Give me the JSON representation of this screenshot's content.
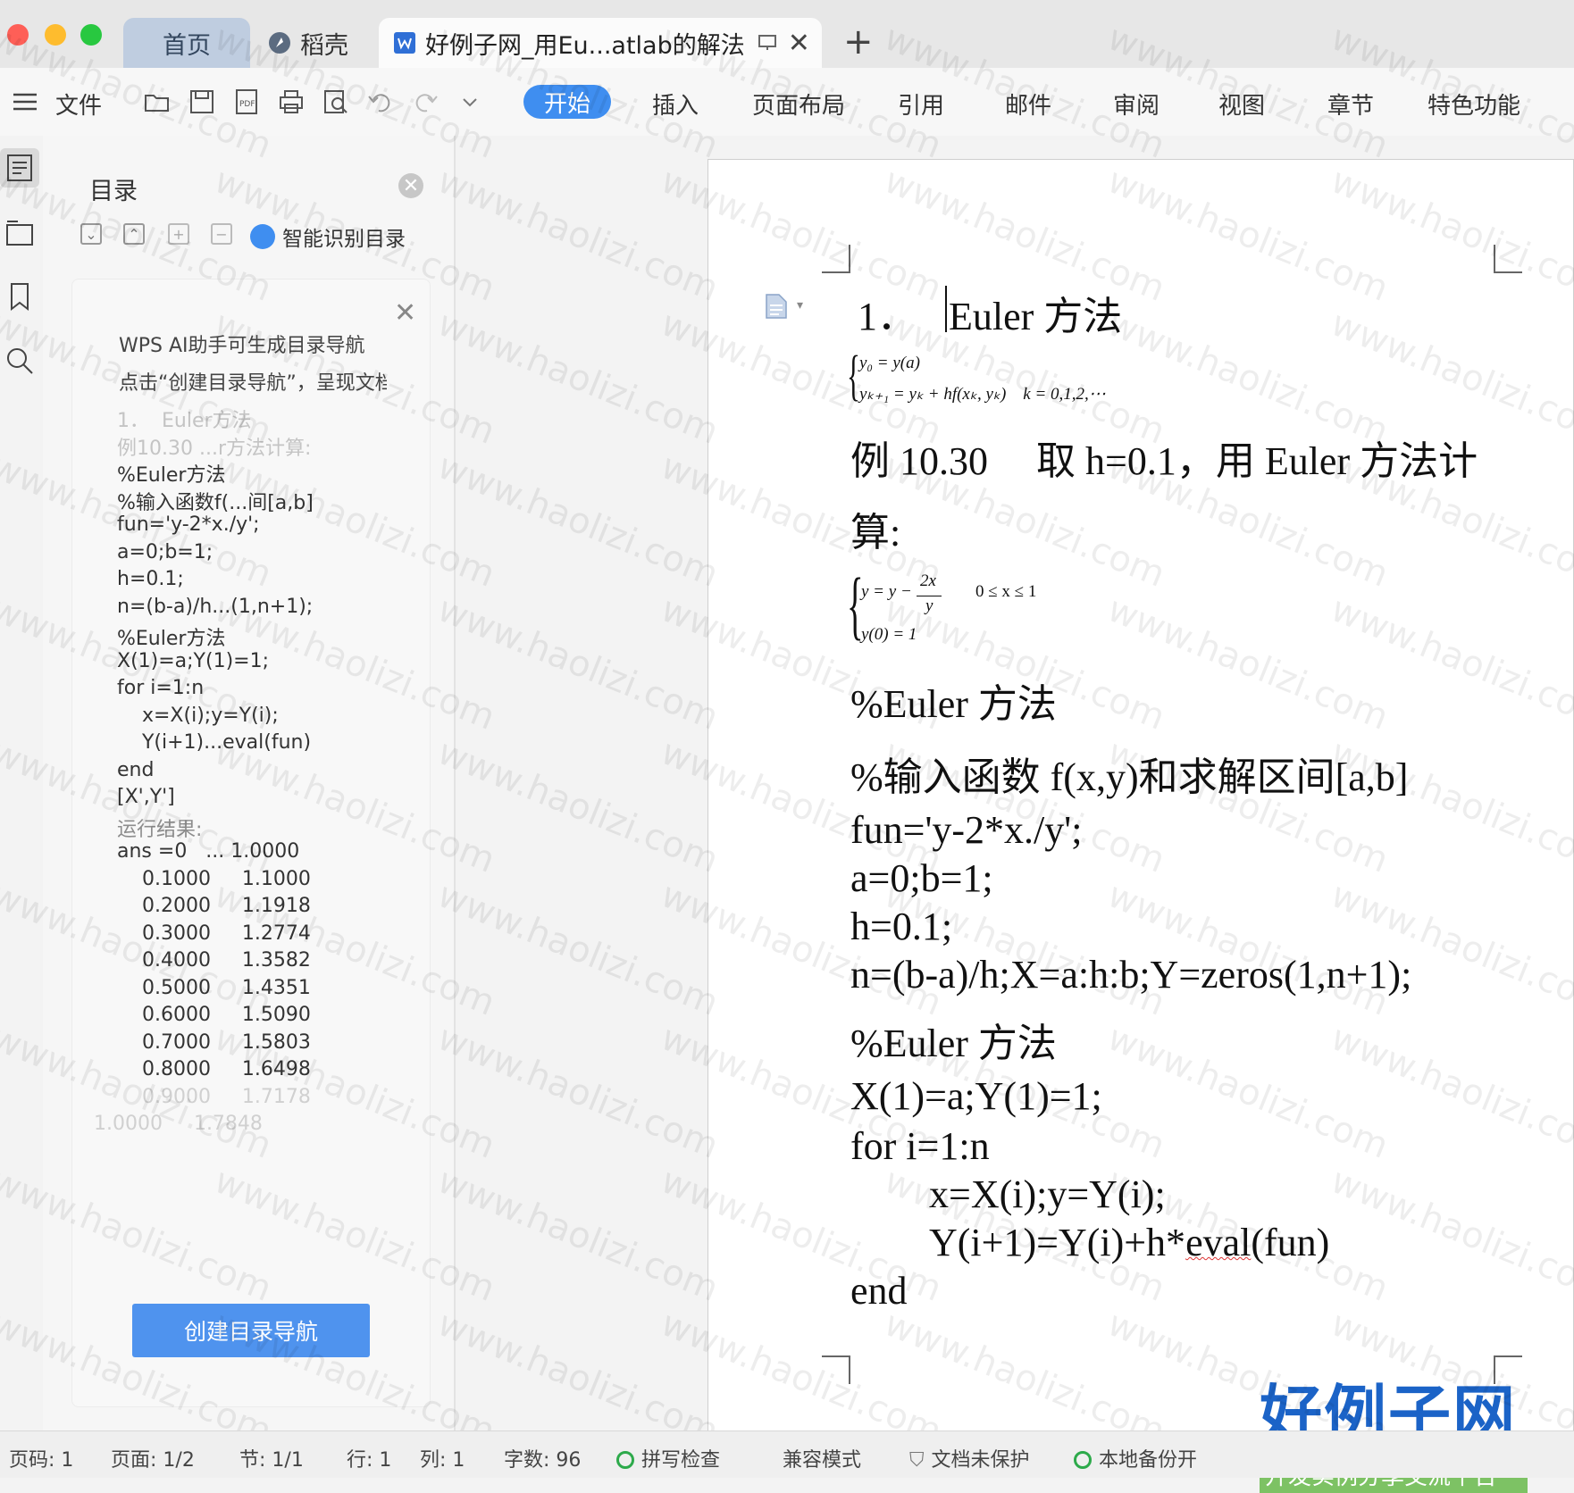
{
  "tabs": {
    "home": "首页",
    "daoke": "稻壳",
    "doc": "好例子网_用Eu...atlab的解法",
    "add": "+"
  },
  "menu": {
    "file": "文件",
    "start": "开始",
    "insert": "插入",
    "layout": "页面布局",
    "reference": "引用",
    "mail": "邮件",
    "review": "审阅",
    "view": "视图",
    "chapter": "章节",
    "special": "特色功能"
  },
  "toc": {
    "title": "目录",
    "smart": "智能识别目录",
    "ai_line1": "WPS AI助手可生成目录导航",
    "ai_line2": "点击“创建目录导航”，呈现文档",
    "entries": [
      "1．  Euler方法",
      "例10.30 ...r方法计算:",
      "%Euler方法",
      "%输入函数f(...间[a,b]",
      "fun='y-2*x./y';",
      "a=0;b=1;",
      "h=0.1;",
      "n=(b-a)/h...(1,n+1);",
      "%Euler方法",
      "X(1)=a;Y(1)=1;",
      "for i=1:n",
      "    x=X(i);y=Y(i);",
      "    Y(i+1)...eval(fun)",
      "end",
      "[X',Y']",
      "运行结果:",
      "ans =0   ... 1.0000",
      "    0.1000     1.1000",
      "    0.2000     1.1918",
      "    0.3000     1.2774",
      "    0.4000     1.3582",
      "    0.5000     1.4351",
      "    0.6000     1.5090",
      "    0.7000     1.5803",
      "    0.8000     1.6498",
      "    0.9000     1.7178",
      "1.0000     1.7848"
    ],
    "create_button": "创建目录导航"
  },
  "doc": {
    "heading_num": "1．",
    "heading": "Euler 方法",
    "f1_line1": "y₀ = y(a)",
    "f1_line2": "yₖ₊₁ = yₖ + hf(xₖ, yₖ)    k = 0,1,2,⋯",
    "example_a": "例 10.30",
    "example_b": "取 h=0.1，用 Euler 方法计",
    "example_c": "算:",
    "f2_lhs": "y = y −",
    "f2_num": "2x",
    "f2_den": "y",
    "f2_range": "0 ≤ x ≤ 1",
    "f2_line2": "y(0) = 1",
    "lines": [
      "%Euler 方法",
      "%输入函数 f(x,y)和求解区间[a,b]",
      "fun='y-2*x./y';",
      "a=0;b=1;",
      "h=0.1;",
      "n=(b-a)/h;X=a:h:b;Y=zeros(1,n+1);",
      "%Euler 方法",
      "X(1)=a;Y(1)=1;",
      "for i=1:n",
      "x=X(i);y=Y(i);",
      "Y(i+1)=Y(i)+h*",
      "eval",
      "(fun)",
      "end"
    ]
  },
  "logo": {
    "main": "好例子网",
    "sub": "开发实例分享交流平台"
  },
  "watermark": "www.haolizi.com",
  "status": {
    "page": "页码: 1",
    "pages": "页面: 1/2",
    "section": "节: 1/1",
    "row": "行: 1",
    "col": "列: 1",
    "words": "字数: 96",
    "spell": "拼写检查",
    "compat": "兼容模式",
    "protect": "文档未保护",
    "backup": "本地备份开"
  },
  "colors": {
    "accent": "#3f8ef0",
    "tab_home": "#bfcde0",
    "logo_blue": "#1b63c7",
    "logo_green": "#7dc264"
  }
}
